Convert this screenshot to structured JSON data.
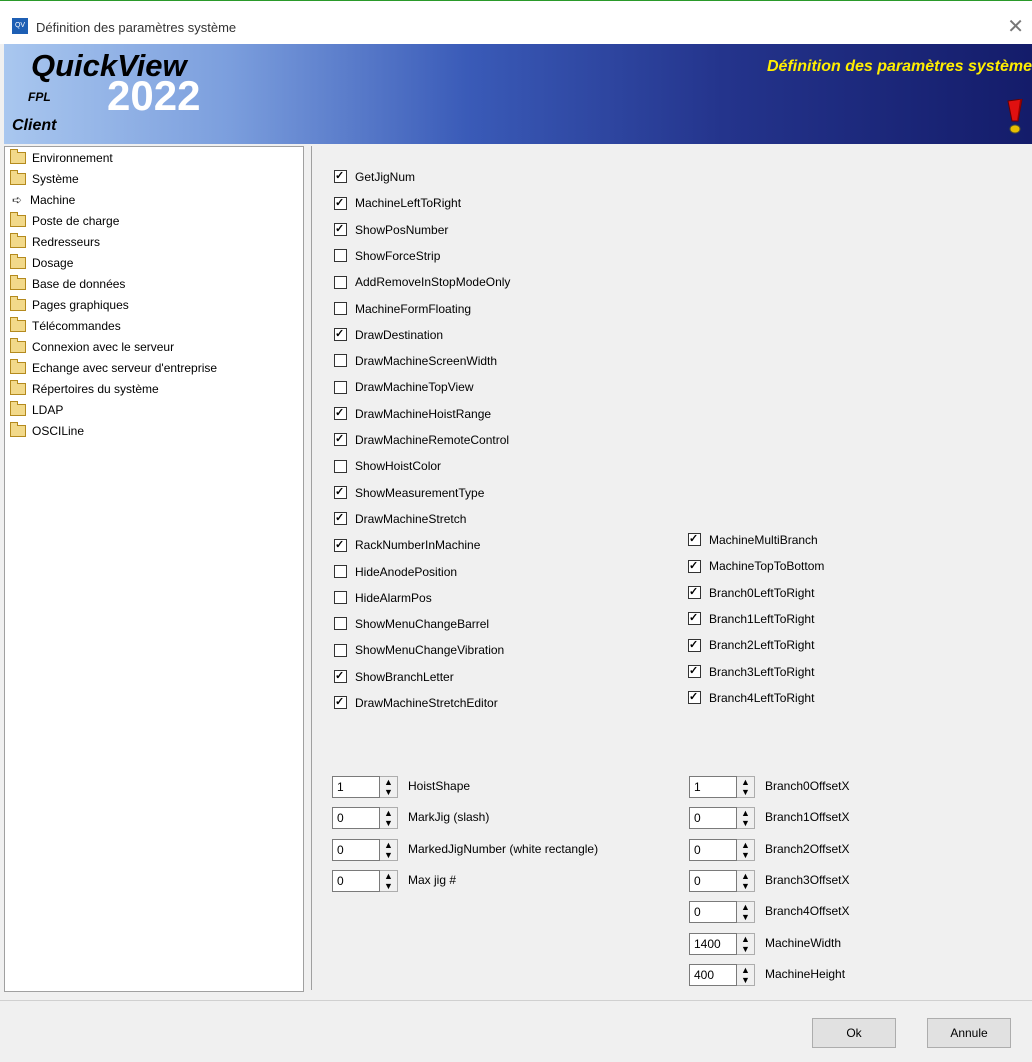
{
  "window": {
    "title": "Définition des paramètres système",
    "icon_label": "QV",
    "close_symbol": "✕"
  },
  "banner": {
    "brand_name": "QuickView",
    "year": "2022",
    "brand_sub": "FPL",
    "edition": "Client",
    "title": "Définition des paramètres système",
    "accent": "#ffee00"
  },
  "tree": {
    "items": [
      {
        "label": "Environnement",
        "icon": "folder-icon"
      },
      {
        "label": "Système",
        "icon": "folder-icon"
      },
      {
        "label": "Machine",
        "icon": "arrow-icon"
      },
      {
        "label": "Poste de charge",
        "icon": "folder-icon"
      },
      {
        "label": "Redresseurs",
        "icon": "folder-icon"
      },
      {
        "label": "Dosage",
        "icon": "folder-icon"
      },
      {
        "label": "Base de données",
        "icon": "folder-icon"
      },
      {
        "label": "Pages graphiques",
        "icon": "folder-icon"
      },
      {
        "label": "Télécommandes",
        "icon": "folder-icon"
      },
      {
        "label": "Connexion avec le serveur",
        "icon": "folder-icon"
      },
      {
        "label": "Echange avec serveur d'entreprise",
        "icon": "folder-icon"
      },
      {
        "label": "Répertoires du système",
        "icon": "folder-icon"
      },
      {
        "label": "LDAP",
        "icon": "folder-icon"
      },
      {
        "label": "OSCILine",
        "icon": "folder-icon"
      }
    ]
  },
  "checkboxes_left": [
    {
      "label": "GetJigNum",
      "checked": true
    },
    {
      "label": "MachineLeftToRight",
      "checked": true
    },
    {
      "label": "ShowPosNumber",
      "checked": true
    },
    {
      "label": "ShowForceStrip",
      "checked": false
    },
    {
      "label": "AddRemoveInStopModeOnly",
      "checked": false
    },
    {
      "label": "MachineFormFloating",
      "checked": false
    },
    {
      "label": "DrawDestination",
      "checked": true
    },
    {
      "label": "DrawMachineScreenWidth",
      "checked": false
    },
    {
      "label": "DrawMachineTopView",
      "checked": false
    },
    {
      "label": "DrawMachineHoistRange",
      "checked": true
    },
    {
      "label": "DrawMachineRemoteControl",
      "checked": true
    },
    {
      "label": "ShowHoistColor",
      "checked": false
    },
    {
      "label": "ShowMeasurementType",
      "checked": true
    },
    {
      "label": "DrawMachineStretch",
      "checked": true
    },
    {
      "label": "RackNumberInMachine",
      "checked": true
    },
    {
      "label": "HideAnodePosition",
      "checked": false
    },
    {
      "label": "HideAlarmPos",
      "checked": false
    },
    {
      "label": "ShowMenuChangeBarrel",
      "checked": false
    },
    {
      "label": "ShowMenuChangeVibration",
      "checked": false
    },
    {
      "label": "ShowBranchLetter",
      "checked": true
    },
    {
      "label": "DrawMachineStretchEditor",
      "checked": true
    }
  ],
  "checkboxes_right": [
    {
      "label": "MachineMultiBranch",
      "checked": true
    },
    {
      "label": "MachineTopToBottom",
      "checked": true
    },
    {
      "label": "Branch0LeftToRight",
      "checked": true
    },
    {
      "label": "Branch1LeftToRight",
      "checked": true
    },
    {
      "label": "Branch2LeftToRight",
      "checked": true
    },
    {
      "label": "Branch3LeftToRight",
      "checked": true
    },
    {
      "label": "Branch4LeftToRight",
      "checked": true
    }
  ],
  "spinners_left": [
    {
      "value": "1",
      "label": "HoistShape"
    },
    {
      "value": "0",
      "label": "MarkJig (slash)"
    },
    {
      "value": "0",
      "label": "MarkedJigNumber (white rectangle)"
    },
    {
      "value": "0",
      "label": "Max jig #"
    }
  ],
  "spinners_right": [
    {
      "value": "1",
      "label": "Branch0OffsetX"
    },
    {
      "value": "0",
      "label": "Branch1OffsetX"
    },
    {
      "value": "0",
      "label": "Branch2OffsetX"
    },
    {
      "value": "0",
      "label": "Branch3OffsetX"
    },
    {
      "value": "0",
      "label": "Branch4OffsetX"
    },
    {
      "value": "1400",
      "label": "MachineWidth"
    },
    {
      "value": "400",
      "label": "MachineHeight"
    }
  ],
  "footer": {
    "ok_label": "Ok",
    "cancel_label": "Annule"
  }
}
